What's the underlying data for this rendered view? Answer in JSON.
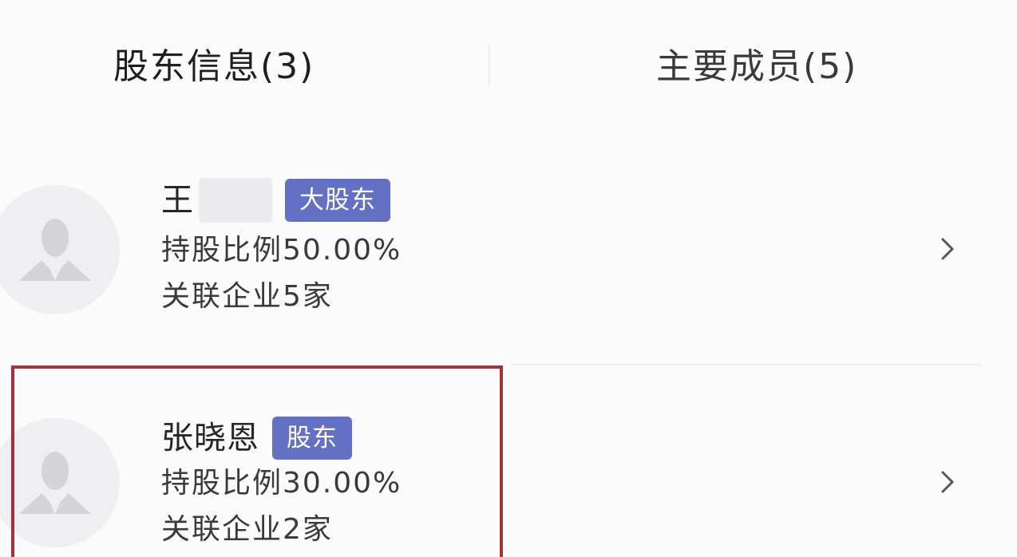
{
  "tabs": [
    {
      "label": "股东信息(3)",
      "active": true
    },
    {
      "label": "主要成员(5)",
      "active": false
    }
  ],
  "shareholders": [
    {
      "name": "王",
      "name_redacted": true,
      "badge": "大股东",
      "share_ratio": "持股比例50.00%",
      "related_companies": "关联企业5家"
    },
    {
      "name": "张晓恩",
      "name_redacted": false,
      "badge": "股东",
      "share_ratio": "持股比例30.00%",
      "related_companies": "关联企业2家",
      "highlighted": true
    }
  ],
  "colors": {
    "badge_bg": "#6470c4",
    "highlight_border": "#a3323c",
    "background": "#fbfbfc"
  },
  "icons": {
    "avatar": "person-silhouette-icon",
    "chevron": "chevron-right-icon"
  }
}
